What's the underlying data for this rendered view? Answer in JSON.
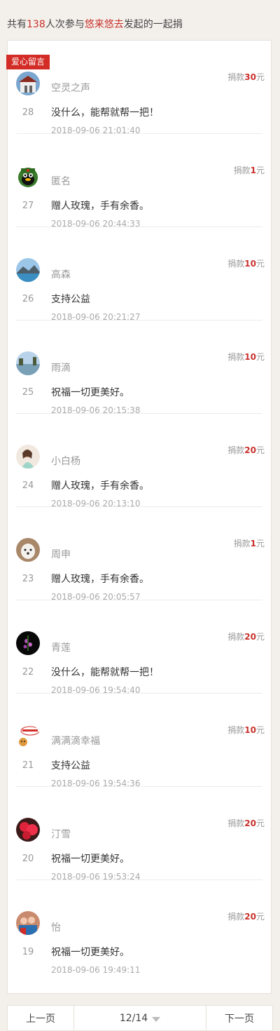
{
  "summary": {
    "prefix": "共有",
    "count": "138",
    "middle": "人次参与",
    "initiator": "悠来悠去",
    "suffix": "发起的一起捐"
  },
  "tag_label": "爱心留言",
  "donate_label": "捐款",
  "currency": "元",
  "items": [
    {
      "index": "28",
      "name": "空灵之声",
      "message": "没什么，能帮就帮一把！",
      "time": "2018-09-06 21:01:40",
      "amount": "30",
      "avatar": "building-photo-avatar"
    },
    {
      "index": "27",
      "name": "匿名",
      "message": "赠人玫瑰，手有余香。",
      "time": "2018-09-06 20:44:33",
      "amount": "1",
      "avatar": "penguin-avatar"
    },
    {
      "index": "26",
      "name": "高森",
      "message": "支持公益",
      "time": "2018-09-06 20:21:27",
      "amount": "10",
      "avatar": "landscape-photo-avatar"
    },
    {
      "index": "25",
      "name": "雨滴",
      "message": "祝福一切更美好。",
      "time": "2018-09-06 20:15:38",
      "amount": "10",
      "avatar": "lake-photo-avatar"
    },
    {
      "index": "24",
      "name": "小白杨",
      "message": "赠人玫瑰，手有余香。",
      "time": "2018-09-06 20:13:10",
      "amount": "20",
      "avatar": "portrait-photo-avatar"
    },
    {
      "index": "23",
      "name": "周申",
      "message": "赠人玫瑰，手有余香。",
      "time": "2018-09-06 20:05:57",
      "amount": "1",
      "avatar": "dog-photo-avatar"
    },
    {
      "index": "22",
      "name": "青莲",
      "message": "没什么，能帮就帮一把！",
      "time": "2018-09-06 19:54:40",
      "amount": "20",
      "avatar": "flower-dark-avatar"
    },
    {
      "index": "21",
      "name": "满满滴幸福",
      "message": "支持公益",
      "time": "2018-09-06 19:54:36",
      "amount": "10",
      "avatar": "cartoon-avatar"
    },
    {
      "index": "20",
      "name": "汀雪",
      "message": "祝福一切更美好。",
      "time": "2018-09-06 19:53:24",
      "amount": "20",
      "avatar": "red-flower-avatar"
    },
    {
      "index": "19",
      "name": "怡",
      "message": "祝福一切更美好。",
      "time": "2018-09-06 19:49:11",
      "amount": "20",
      "avatar": "group-photo-avatar"
    }
  ],
  "pager": {
    "prev": "上一页",
    "current": "12/14",
    "next": "下一页"
  }
}
